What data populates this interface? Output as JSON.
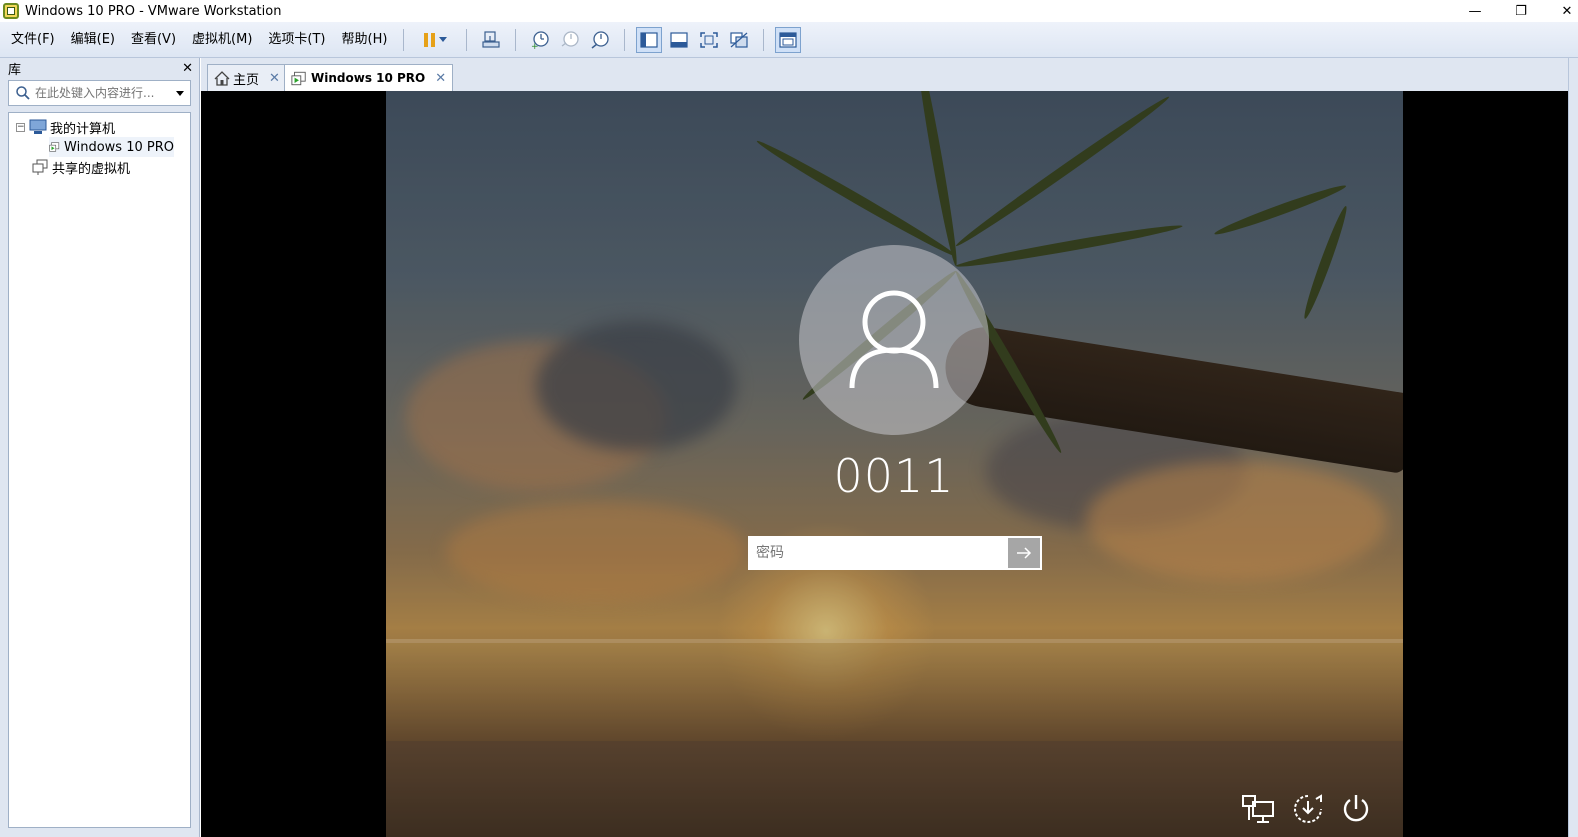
{
  "window": {
    "title": "Windows 10 PRO - VMware Workstation",
    "minimize": "—",
    "restore": "❐",
    "close": "✕"
  },
  "menu": {
    "items": [
      "文件(F)",
      "编辑(E)",
      "查看(V)",
      "虚拟机(M)",
      "选项卡(T)",
      "帮助(H)"
    ]
  },
  "toolbar": {
    "pause_color": "#e6a118"
  },
  "library": {
    "title": "库",
    "close": "✕",
    "search_placeholder": "在此处键入内容进行...",
    "tree": {
      "my_computer": "我的计算机",
      "vm": "Windows 10 PRO",
      "shared": "共享的虚拟机",
      "toggle": "⊟"
    }
  },
  "tabs": {
    "home": "主页",
    "vm": "Windows 10 PRO",
    "close": "✕"
  },
  "login": {
    "username": "0011",
    "password_placeholder": "密码"
  }
}
